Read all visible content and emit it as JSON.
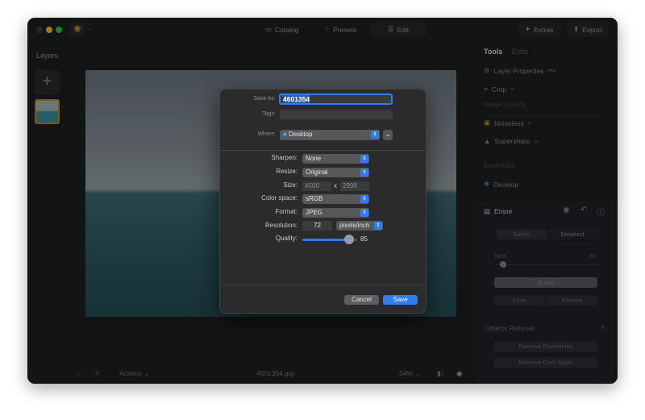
{
  "toolbar": {
    "catalog": "Catalog",
    "presets": "Presets",
    "edit": "Edit",
    "extras": "Extras",
    "export": "Export"
  },
  "layers": {
    "title": "Layers"
  },
  "sidebar": {
    "tab_tools": "Tools",
    "tab_edits": "Edits",
    "items": [
      {
        "label": "Layer Properties",
        "badge": "PRO"
      },
      {
        "label": "Crop",
        "badge": "AI"
      }
    ],
    "image_quality": "Image Quality",
    "quality_items": [
      {
        "label": "Noiseless",
        "badge": "AI"
      },
      {
        "label": "Supersharp",
        "badge": "AI"
      }
    ],
    "essentials": "Essentials",
    "develop": "Develop",
    "erase": {
      "title": "Erase",
      "select": "Select",
      "deselect": "Deselect",
      "size_label": "Size",
      "size_value": "20",
      "size_fraction": 0.08,
      "erase_btn": "Erase",
      "clear": "Clear",
      "restore": "Restore"
    },
    "objects_removal": {
      "title": "Objects Removal",
      "powerlines": "Remove Powerlines",
      "dust": "Remove Dust Spots"
    }
  },
  "bottom": {
    "actions": "Actions",
    "filename": "4601354.jpg",
    "zoom": "34%"
  },
  "dialog": {
    "save_as_label": "Save As:",
    "save_as_value": "4601354",
    "tags_label": "Tags:",
    "where_label": "Where:",
    "where_value": "Desktop",
    "sharpen_label": "Sharpen:",
    "sharpen_value": "None",
    "resize_label": "Resize:",
    "resize_value": "Original",
    "size_label": "Size:",
    "width": "4500",
    "x": "x",
    "height": "2998",
    "colorspace_label": "Color space:",
    "colorspace_value": "sRGB",
    "format_label": "Format:",
    "format_value": "JPEG",
    "resolution_label": "Resolution:",
    "resolution_value": "72",
    "resolution_unit": "pixels/inch",
    "quality_label": "Quality:",
    "quality_value": "85",
    "cancel": "Cancel",
    "save": "Save"
  },
  "colors": {
    "accent": "#2f7cf6",
    "ai_badge": "#b08a2a"
  }
}
